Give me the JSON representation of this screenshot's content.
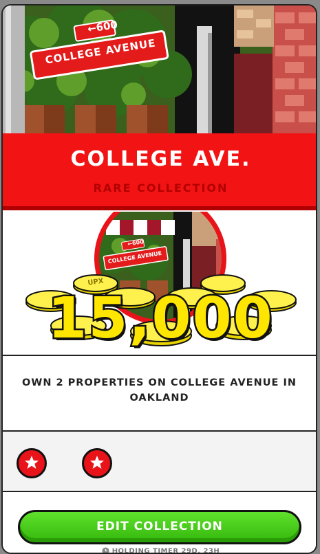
{
  "hero": {
    "sign_number": "600",
    "sign_street": "COLLEGE AVENUE"
  },
  "header": {
    "title": "COLLEGE AVE.",
    "subtitle": "RARE COLLECTION"
  },
  "reward": {
    "amount": "15,000",
    "coin_label": "UPX",
    "badge_sign_number": "600",
    "badge_sign_street": "COLLEGE AVENUE"
  },
  "requirement": {
    "text": "OWN 2 PROPERTIES ON COLLEGE AVENUE IN OAKLAND"
  },
  "properties": {
    "owned_count": 2,
    "icon": "star-icon"
  },
  "actions": {
    "edit_label": "EDIT COLLECTION",
    "timer_label": "HOLDING TIMER 29D, 23H"
  },
  "colors": {
    "header_red": "#f21414",
    "button_green": "#3fc81a",
    "coin_yellow": "#ffe600"
  }
}
